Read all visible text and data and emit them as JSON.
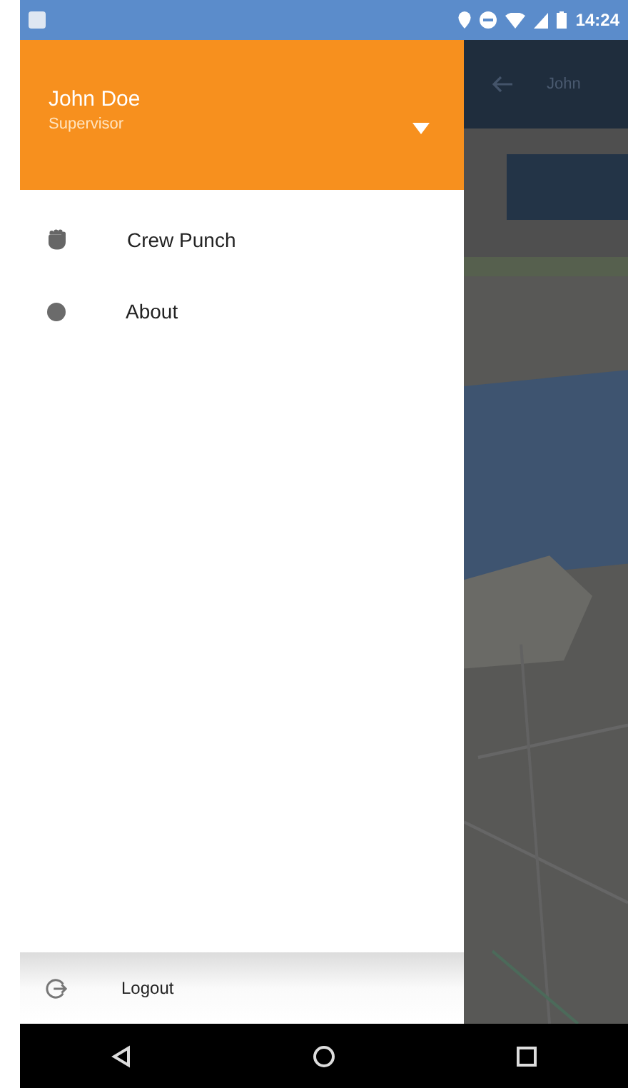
{
  "status_bar": {
    "time": "14:24"
  },
  "drawer": {
    "user": {
      "name": "John Doe",
      "role": "Supervisor"
    },
    "items": [
      {
        "label": "Crew Punch",
        "kind": "fist"
      },
      {
        "label": "About",
        "kind": "dot"
      }
    ],
    "footer": {
      "label": "Logout"
    }
  },
  "app_bar": {
    "title": "John"
  }
}
